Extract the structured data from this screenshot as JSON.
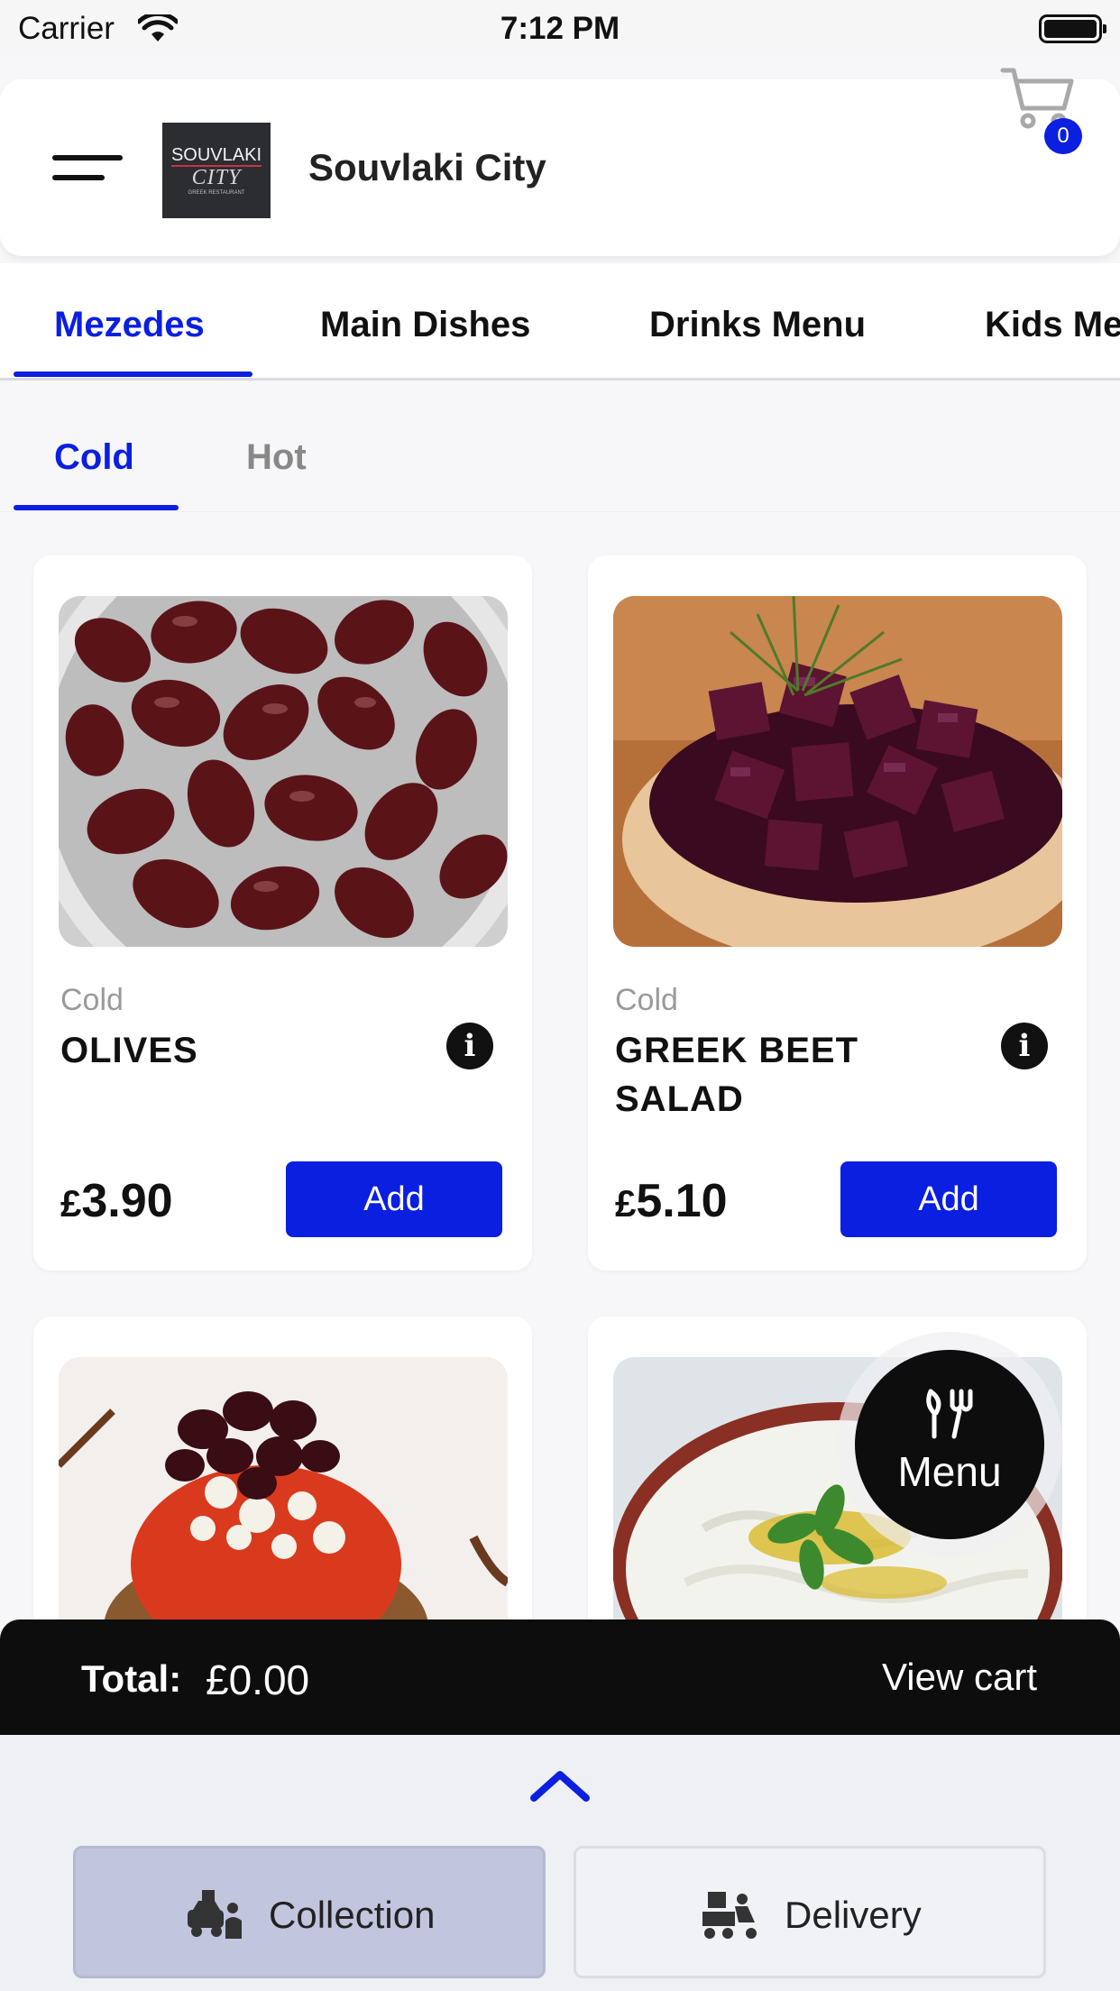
{
  "status_bar": {
    "carrier": "Carrier",
    "time": "7:12 PM"
  },
  "header": {
    "logo": {
      "top": "SOUVLAKI",
      "mid": "CITY",
      "bot": "GREEK RESTAURANT"
    },
    "restaurant_name": "Souvlaki City",
    "cart_count": "0"
  },
  "tabs": [
    {
      "label": "Mezedes",
      "active": true
    },
    {
      "label": "Main Dishes",
      "active": false
    },
    {
      "label": "Drinks Menu",
      "active": false
    },
    {
      "label": "Kids Me",
      "active": false
    }
  ],
  "subtabs": [
    {
      "label": "Cold",
      "active": true
    },
    {
      "label": "Hot",
      "active": false
    }
  ],
  "products": [
    {
      "category": "Cold",
      "name": "OLIVES",
      "currency": "£",
      "price": "3.90",
      "add_label": "Add",
      "info_icon": "i"
    },
    {
      "category": "Cold",
      "name": "GREEK BEET SALAD",
      "currency": "£",
      "price": "5.10",
      "add_label": "Add",
      "info_icon": "i"
    }
  ],
  "fab": {
    "label": "Menu",
    "icon": "fork-knife-icon"
  },
  "total_bar": {
    "label": "Total:",
    "value": "£0.00",
    "view_cart": "View cart"
  },
  "order_mode": {
    "collection": {
      "label": "Collection",
      "selected": true
    },
    "delivery": {
      "label": "Delivery",
      "selected": false
    }
  },
  "colors": {
    "accent": "#0b1fe0",
    "dark": "#0d0d0d",
    "selected_mode": "#c1c6de"
  }
}
